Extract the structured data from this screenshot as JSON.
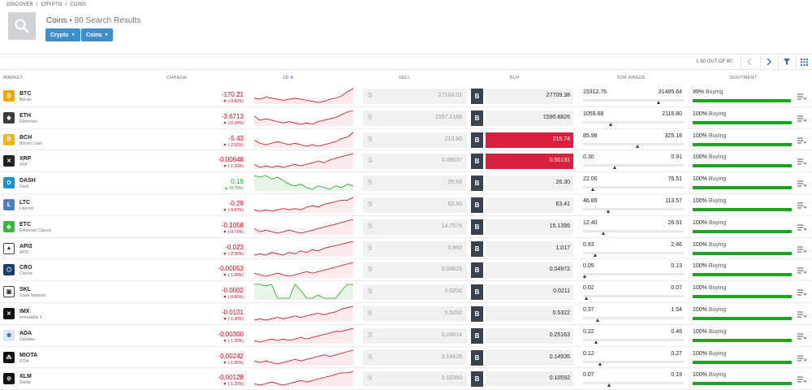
{
  "breadcrumb": [
    "DISCOVER",
    "/",
    "CRYPTO",
    "/",
    "COINS"
  ],
  "title": "Coins",
  "subtitle": "• 80 Search Results",
  "filters": [
    {
      "label": "Crypto"
    },
    {
      "label": "Coins"
    }
  ],
  "pager": {
    "text": "1-50 OUT OF 80"
  },
  "headers": {
    "market": "MARKET",
    "change": "CHANGE",
    "period": "1D",
    "sell": "SELL",
    "buy": "BUY",
    "range": "52W RANGE",
    "sentiment": "SENTIMENT"
  },
  "colors": {
    "negative": "#d0021b",
    "positive": "#1aa31a",
    "accent": "#3d8fd1",
    "buy_highlight": "#d9213b",
    "sentiment_bar": "#1ea31a"
  },
  "rows": [
    {
      "sym": "BTC",
      "name": "Bitcoin",
      "icon": "bitcoin-icon",
      "color": "#f7a600",
      "change": "-170.21",
      "pct": "(-0.62%)",
      "dir": "neg",
      "sell_s": "S",
      "sell": "27104.01",
      "buy_b": "B",
      "buy": "27709.38",
      "buy_hl": false,
      "low": "15312.76",
      "high": "31485.64",
      "range_pos": 0.76,
      "sent_pct": "99%",
      "sent_label": "Buying",
      "sent_val": 0.99,
      "spark": [
        6,
        5,
        7,
        6,
        5,
        4,
        5,
        6,
        5,
        4,
        3,
        2,
        3,
        5,
        6,
        8,
        12,
        15
      ]
    },
    {
      "sym": "ETH",
      "name": "Ethereum",
      "icon": "ethereum-icon",
      "color": "#3b3b3b",
      "change": "-3.6713",
      "pct": "(-0.24%)",
      "dir": "neg",
      "sell_s": "S",
      "sell": "1557.2166",
      "buy_b": "B",
      "buy": "1590.8826",
      "buy_hl": false,
      "low": "1059.68",
      "high": "2116.80",
      "range_pos": 0.27,
      "sent_pct": "100%",
      "sent_label": "Buying",
      "sent_val": 1.0,
      "spark": [
        9,
        6,
        7,
        6,
        5,
        4,
        5,
        4,
        3,
        4,
        3,
        5,
        6,
        7,
        8,
        10,
        12,
        13
      ]
    },
    {
      "sym": "BCH",
      "name": "Bitcoin Cash",
      "icon": "bitcoin-cash-icon",
      "color": "#f2b51e",
      "change": "-5.43",
      "pct": "(-2.51%)",
      "dir": "neg",
      "sell_s": "S",
      "sell": "210.80",
      "buy_b": "B",
      "buy": "215.74",
      "buy_hl": true,
      "low": "85.98",
      "high": "325.18",
      "range_pos": 0.54,
      "sent_pct": "100%",
      "sent_label": "Buying",
      "sent_val": 1.0,
      "spark": [
        7,
        5,
        4,
        5,
        6,
        5,
        4,
        5,
        4,
        3,
        4,
        3,
        4,
        5,
        6,
        8,
        9,
        12
      ]
    },
    {
      "sym": "XRP",
      "name": "XRP",
      "icon": "xrp-icon",
      "color": "#222222",
      "change": "-0.00648",
      "pct": "(-1.30%)",
      "dir": "neg",
      "sell_s": "S",
      "sell": "0.49037",
      "buy_b": "B",
      "buy": "0.50131",
      "buy_hl": true,
      "low": "0.30",
      "high": "0.91",
      "range_pos": 0.31,
      "sent_pct": "100%",
      "sent_label": "Buying",
      "sent_val": 1.0,
      "spark": [
        6,
        4,
        5,
        4,
        5,
        4,
        5,
        6,
        5,
        6,
        7,
        8,
        7,
        9,
        10,
        11,
        12,
        13
      ]
    },
    {
      "sym": "DASH",
      "name": "Dash",
      "icon": "dash-icon",
      "color": "#1e90d6",
      "change": "0.19",
      "pct": "(0.75%)",
      "dir": "pos",
      "sell_s": "S",
      "sell": "25.68",
      "buy_b": "B",
      "buy": "26.30",
      "buy_hl": false,
      "low": "22.00",
      "high": "76.51",
      "range_pos": 0.08,
      "sent_pct": "100%",
      "sent_label": "Buying",
      "sent_val": 1.0,
      "spark": [
        12,
        11,
        12,
        10,
        11,
        9,
        7,
        6,
        7,
        5,
        4,
        6,
        5,
        4,
        6,
        5,
        7,
        6
      ]
    },
    {
      "sym": "LTC",
      "name": "Litecoin",
      "icon": "litecoin-icon",
      "color": "#4a7fc1",
      "change": "-0.29",
      "pct": "(-0.47%)",
      "dir": "neg",
      "sell_s": "S",
      "sell": "62.80",
      "buy_b": "B",
      "buy": "63.41",
      "buy_hl": false,
      "low": "46.89",
      "high": "113.57",
      "range_pos": 0.24,
      "sent_pct": "100%",
      "sent_label": "Buying",
      "sent_val": 1.0,
      "spark": [
        5,
        4,
        5,
        4,
        5,
        6,
        5,
        6,
        5,
        7,
        8,
        7,
        9,
        10,
        11,
        12,
        12,
        14
      ]
    },
    {
      "sym": "ETC",
      "name": "Ethereum Classic",
      "icon": "ethereum-classic-icon",
      "color": "#3ab83a",
      "change": "-0.1058",
      "pct": "(-0.71%)",
      "dir": "neg",
      "sell_s": "S",
      "sell": "14.7578",
      "buy_b": "B",
      "buy": "15.1395",
      "buy_hl": false,
      "low": "12.40",
      "high": "26.91",
      "range_pos": 0.19,
      "sent_pct": "100%",
      "sent_label": "Buying",
      "sent_val": 1.0,
      "spark": [
        7,
        5,
        6,
        5,
        4,
        5,
        6,
        5,
        4,
        5,
        6,
        7,
        8,
        9,
        10,
        11,
        12,
        13
      ]
    },
    {
      "sym": "API3",
      "name": "API3",
      "icon": "api3-icon",
      "color": "#ffffff",
      "change": "-0.023",
      "pct": "(-2.26%)",
      "dir": "neg",
      "sell_s": "S",
      "sell": "0.993",
      "buy_b": "B",
      "buy": "1.017",
      "buy_hl": false,
      "low": "0.83",
      "high": "2.46",
      "range_pos": 0.11,
      "sent_pct": "100%",
      "sent_label": "Buying",
      "sent_val": 1.0,
      "spark": [
        4,
        5,
        4,
        6,
        5,
        4,
        6,
        5,
        7,
        6,
        8,
        7,
        9,
        10,
        11,
        12,
        13,
        14
      ]
    },
    {
      "sym": "CRO",
      "name": "Cronos",
      "icon": "cronos-icon",
      "color": "#1c3e6e",
      "change": "-0.00053",
      "pct": "(-1.09%)",
      "dir": "neg",
      "sell_s": "S",
      "sell": "0.04828",
      "buy_b": "B",
      "buy": "0.04972",
      "buy_hl": false,
      "low": "0.05",
      "high": "0.13",
      "range_pos": 0.0,
      "sent_pct": "100%",
      "sent_label": "Buying",
      "sent_val": 1.0,
      "spark": [
        6,
        5,
        4,
        5,
        6,
        5,
        4,
        5,
        6,
        7,
        6,
        7,
        8,
        9,
        10,
        11,
        12,
        13
      ]
    },
    {
      "sym": "SKL",
      "name": "Skale Network",
      "icon": "skale-icon",
      "color": "#ffffff",
      "change": "-0.0002",
      "pct": "(-0.96%)",
      "dir": "neg",
      "sell_s": "S",
      "sell": "0.0206",
      "buy_b": "B",
      "buy": "0.0211",
      "buy_hl": false,
      "low": "0.02",
      "high": "0.07",
      "range_pos": 0.02,
      "sent_pct": "100%",
      "sent_label": "Buying",
      "sent_val": 1.0,
      "spark": [
        12,
        12,
        11,
        12,
        3,
        3,
        3,
        12,
        8,
        3,
        3,
        5,
        3,
        3,
        3,
        8,
        12,
        12
      ],
      "spark_color": "pos"
    },
    {
      "sym": "IMX",
      "name": "Immutable X",
      "icon": "immutable-x-icon",
      "color": "#111111",
      "change": "-0.0101",
      "pct": "(-1.90%)",
      "dir": "neg",
      "sell_s": "S",
      "sell": "0.5202",
      "buy_b": "B",
      "buy": "0.5322",
      "buy_hl": false,
      "low": "0.37",
      "high": "1.54",
      "range_pos": 0.13,
      "sent_pct": "100%",
      "sent_label": "Buying",
      "sent_val": 1.0,
      "spark": [
        4,
        5,
        4,
        5,
        6,
        5,
        6,
        7,
        6,
        7,
        8,
        9,
        8,
        9,
        10,
        12,
        13,
        14
      ]
    },
    {
      "sym": "ADA",
      "name": "Cardano",
      "icon": "cardano-icon",
      "color": "#d6e9f8",
      "change": "-0.00300",
      "pct": "(-1.20%)",
      "dir": "neg",
      "sell_s": "S",
      "sell": "0.24614",
      "buy_b": "B",
      "buy": "0.25163",
      "buy_hl": false,
      "low": "0.22",
      "high": "0.46",
      "range_pos": 0.12,
      "sent_pct": "100%",
      "sent_label": "Buying",
      "sent_val": 1.0,
      "spark": [
        5,
        4,
        5,
        6,
        5,
        6,
        5,
        6,
        7,
        6,
        7,
        8,
        9,
        10,
        11,
        11,
        12,
        13
      ]
    },
    {
      "sym": "MIOTA",
      "name": "IOTA",
      "icon": "iota-icon",
      "color": "#111111",
      "change": "-0.00242",
      "pct": "(-1.65%)",
      "dir": "neg",
      "sell_s": "S",
      "sell": "0.14426",
      "buy_b": "B",
      "buy": "0.14935",
      "buy_hl": false,
      "low": "0.12",
      "high": "0.27",
      "range_pos": 0.16,
      "sent_pct": "100%",
      "sent_label": "Buying",
      "sent_val": 1.0,
      "spark": [
        6,
        5,
        6,
        5,
        4,
        5,
        6,
        7,
        6,
        7,
        8,
        9,
        10,
        9,
        10,
        11,
        12,
        13
      ]
    },
    {
      "sym": "XLM",
      "name": "Stellar",
      "icon": "stellar-icon",
      "color": "#111111",
      "change": "-0.00128",
      "pct": "(-1.22%)",
      "dir": "neg",
      "sell_s": "S",
      "sell": "0.10350",
      "buy_b": "B",
      "buy": "0.10592",
      "buy_hl": false,
      "low": "0.07",
      "high": "0.19",
      "range_pos": 0.25,
      "sent_pct": "100%",
      "sent_label": "Buying",
      "sent_val": 1.0,
      "spark": [
        5,
        4,
        5,
        6,
        5,
        4,
        5,
        6,
        7,
        6,
        7,
        8,
        9,
        10,
        11,
        12,
        12,
        13
      ]
    }
  ]
}
